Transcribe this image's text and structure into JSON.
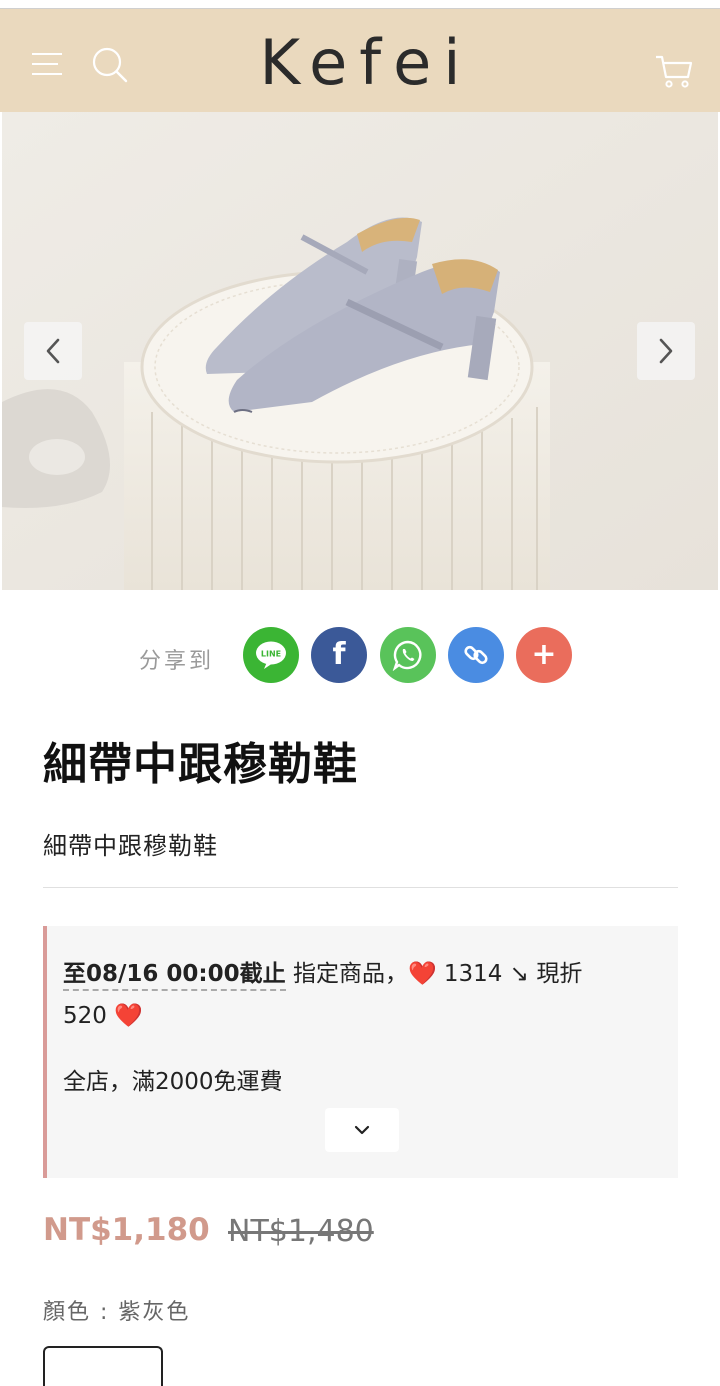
{
  "header": {
    "brand": "Kefei",
    "background": "#ead9be",
    "icons": [
      "menu-icon",
      "search-icon",
      "cart-icon"
    ]
  },
  "gallery": {
    "image_description": "lavender-grey square-toe slingback mules on white pedestal",
    "slide_count": 2,
    "active_slide": 2
  },
  "share": {
    "label": "分享到",
    "buttons": [
      {
        "name": "line",
        "text": "LINE",
        "color": "#3bb534"
      },
      {
        "name": "facebook",
        "text": "f",
        "color": "#3b5998"
      },
      {
        "name": "whatsapp",
        "text": "",
        "color": "#59c35a"
      },
      {
        "name": "copy-link",
        "text": "",
        "color": "#4a8ce2"
      },
      {
        "name": "more",
        "text": "+",
        "color": "#ea6d5c"
      }
    ]
  },
  "product": {
    "title": "細帶中跟穆勒鞋",
    "subtitle": "細帶中跟穆勒鞋",
    "price": "NT$1,180",
    "original_price": "NT$1,480",
    "price_color": "#d19a8c"
  },
  "promo": {
    "line1_strong": "至08/16 00:00截止",
    "line1_rest": " 指定商品，❤️ 1314 ↘ 現折",
    "line2": "520 ❤️",
    "line3": "全店，滿2000免運費",
    "accent": "#d99b98"
  },
  "variant": {
    "label": "顏色 : 紫灰色"
  }
}
